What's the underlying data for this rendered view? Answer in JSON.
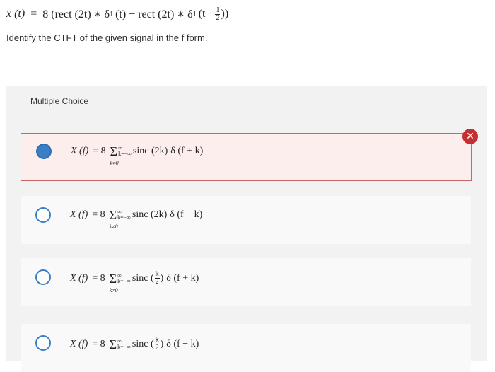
{
  "equation": {
    "lhs": "x (t)",
    "eq": "=",
    "rhs_a": "8 (rect (2t) ∗ δ",
    "rhs_a_sub": "1",
    "rhs_b": "(t) − rect (2t) ∗ δ",
    "rhs_b_sub": "1",
    "rhs_c": "(t −",
    "frac_num": "1",
    "frac_den": "2",
    "rhs_d": "))"
  },
  "question": "Identify the CTFT of the given signal in the f form.",
  "panel": {
    "label": "Multiple Choice"
  },
  "options": [
    {
      "lhs": "X (f)",
      "eq": "= 8",
      "upper": "∞",
      "lower": "k=−∞",
      "excl": "k≠0",
      "term": "sinc (2k)",
      "delta": "δ (f + k)",
      "selected": true,
      "marked_wrong": true
    },
    {
      "lhs": "X (f)",
      "eq": "= 8",
      "upper": "∞",
      "lower": "k=−∞",
      "excl": "k≠0",
      "term": "sinc (2k)",
      "delta": "δ (f − k)",
      "selected": false
    },
    {
      "lhs": "X (f)",
      "eq": "= 8",
      "upper": "∞",
      "lower": "k=−∞",
      "excl": "k≠0",
      "term_pre": "sinc (",
      "frac_num": "k",
      "frac_den": "2",
      "term_post": ")",
      "delta": "δ (f + k)",
      "selected": false
    },
    {
      "lhs": "X (f)",
      "eq": "= 8",
      "upper": "∞",
      "lower": "k=−∞",
      "term_pre": "sinc (",
      "frac_num": "k",
      "frac_den": "2",
      "term_post": ")",
      "delta": "δ (f − k)",
      "selected": false
    }
  ],
  "colors": {
    "accent": "#3a7fc4",
    "wrong": "#c62f2f",
    "selected_bg": "#fdeeee",
    "selected_border": "#c96767"
  },
  "icons": {
    "wrong_badge": "close-x-icon"
  }
}
